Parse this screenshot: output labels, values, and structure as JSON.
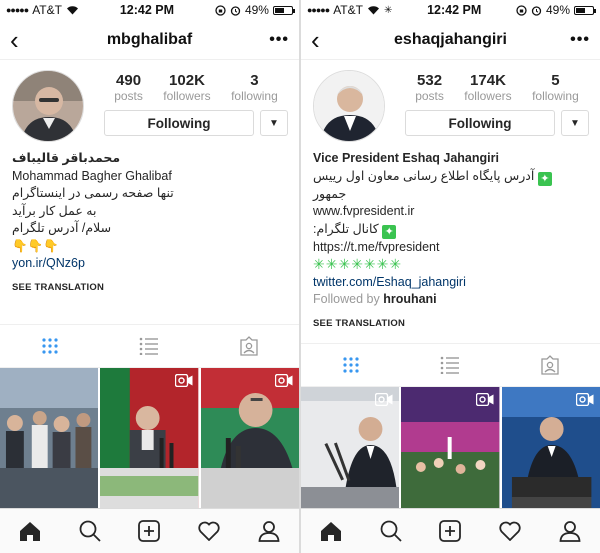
{
  "left": {
    "status": {
      "carrier": "AT&T",
      "time": "12:42 PM",
      "battery": "49%",
      "battery_level": 0.49
    },
    "username": "mbghalibaf",
    "stats": [
      {
        "num": "490",
        "label": "posts"
      },
      {
        "num": "102K",
        "label": "followers"
      },
      {
        "num": "3",
        "label": "following"
      }
    ],
    "follow_label": "Following",
    "bio": {
      "name": "محمدباقر قالیباف",
      "lines": [
        "Mohammad Bagher Ghalibaf",
        "تنها صفحه رسمی در اینستاگرام",
        "به عمل کار برآید",
        "سلام/ آدرس تلگرام",
        "👇👇👇"
      ],
      "link": "yon.ir/QNz6p"
    },
    "see_translation": "SEE TRANSLATION"
  },
  "right": {
    "status": {
      "carrier": "AT&T",
      "time": "12:42 PM",
      "battery": "49%",
      "battery_level": 0.49
    },
    "username": "eshaqjahangiri",
    "stats": [
      {
        "num": "532",
        "label": "posts"
      },
      {
        "num": "174K",
        "label": "followers"
      },
      {
        "num": "5",
        "label": "following"
      }
    ],
    "follow_label": "Following",
    "bio": {
      "name": "Vice President Eshaq Jahangiri",
      "line1": "آدرس پایگاه اطلاع رسانی معاون اول رییس جمهور",
      "line2": "www.fvpresident.ir",
      "line3": "کانال تلگرام:",
      "line4": "https://t.me/fvpresident",
      "stars": "✳✳✳✳✳✳✳",
      "link": "twitter.com/Eshaq_jahangiri",
      "followed_by_prefix": "Followed by",
      "followed_by_user": "hrouhani"
    },
    "see_translation": "SEE TRANSLATION"
  },
  "icons": [
    "back-icon",
    "more-icon",
    "grid-view-icon",
    "list-view-icon",
    "tagged-icon",
    "home-icon",
    "search-icon",
    "add-icon",
    "heart-icon",
    "profile-icon",
    "video-icon"
  ],
  "colors": {
    "tab_active": "#3897f0",
    "link": "#003569",
    "muted": "#999999",
    "check_emoji": "#3ac350"
  }
}
